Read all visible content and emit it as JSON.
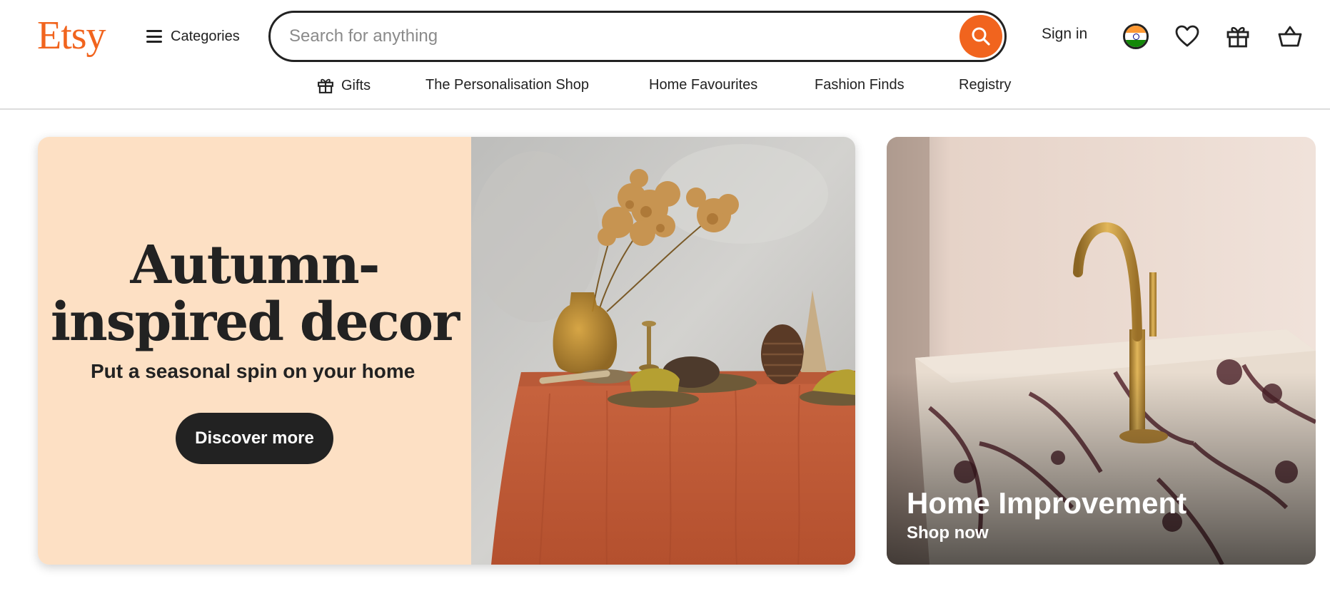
{
  "brand": {
    "logo_text": "Etsy",
    "accent_color": "#f1641e"
  },
  "header": {
    "categories_label": "Categories",
    "categories_icon": "hamburger-menu-icon",
    "search": {
      "placeholder": "Search for anything",
      "value": "",
      "button_icon": "search-icon"
    },
    "sign_in_label": "Sign in",
    "icons": [
      "india-flag-icon",
      "heart-icon",
      "gift-icon",
      "shopping-basket-icon"
    ]
  },
  "nav": {
    "items": [
      {
        "label": "Gifts",
        "icon": "gift-icon"
      },
      {
        "label": "The Personalisation Shop"
      },
      {
        "label": "Home Favourites"
      },
      {
        "label": "Fashion Finds"
      },
      {
        "label": "Registry"
      }
    ]
  },
  "hero": {
    "title_line1": "Autumn-",
    "title_line2": "inspired decor",
    "subtitle": "Put a seasonal spin on your home",
    "cta_label": "Discover more",
    "background_color": "#fde0c4"
  },
  "side_card": {
    "title": "Home Improvement",
    "cta_label": "Shop now"
  }
}
